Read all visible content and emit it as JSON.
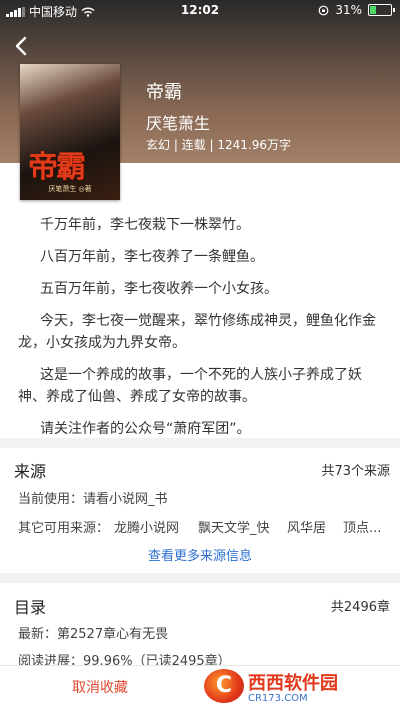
{
  "status": {
    "carrier": "中国移动",
    "time": "12:02",
    "battery": "31%",
    "battery_level": 0.31
  },
  "book": {
    "title": "帝霸",
    "author": "厌笔萧生",
    "meta": "玄幻 | 连载 | 1241.96万字",
    "cover_title": "帝霸",
    "cover_author": "厌笔萧生 ◎著"
  },
  "description": [
    "千万年前，李七夜栽下一株翠竹。",
    "八百万年前，李七夜养了一条鲤鱼。",
    "五百万年前，李七夜收养一个小女孩。",
    "今天，李七夜一觉醒来，翠竹修练成神灵，鲤鱼化作金龙，小女孩成为九界女帝。",
    "这是一个养成的故事，一个不死的人族小子养成了妖神、养成了仙兽、养成了女帝的故事。",
    "请关注作者的公众号“萧府军团”。"
  ],
  "source": {
    "title": "来源",
    "count": "共73个来源",
    "current_label": "当前使用：",
    "current_value": "请看小说网_书",
    "others_label": "其它可用来源：",
    "others": [
      "龙腾小说网",
      "飘天文学_快",
      "风华居",
      "顶点..."
    ],
    "more_link": "查看更多来源信息"
  },
  "toc": {
    "title": "目录",
    "count": "共2496章",
    "latest_label": "最新：",
    "latest_value": "第2527章心有无畏",
    "progress_label": "阅读进展：",
    "progress_value": "99.96%（已读2495章）"
  },
  "bottom": {
    "uncollect": "取消收藏"
  },
  "watermark": {
    "logo": "C",
    "main": "西西软件园",
    "sub": "CR173.COM"
  }
}
